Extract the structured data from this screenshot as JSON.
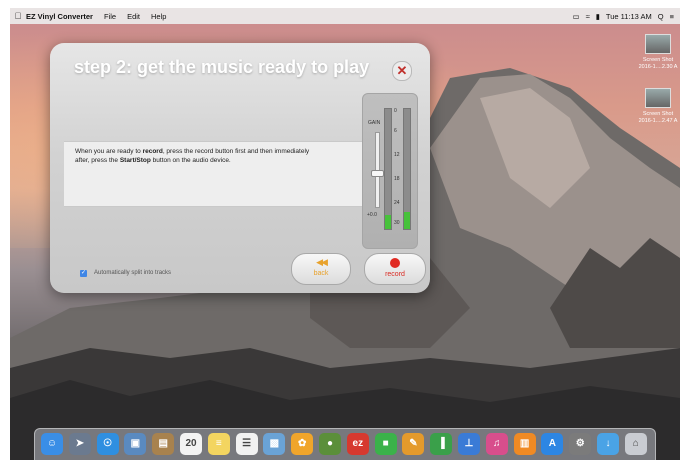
{
  "menubar": {
    "apple": "",
    "app_name": "EZ Vinyl Converter",
    "items": [
      "File",
      "Edit",
      "Help"
    ],
    "status": {
      "clock": "Tue 11:13 AM",
      "search": "Q",
      "menu": "≡"
    }
  },
  "desktop_files": [
    {
      "name": "Screen Shot",
      "date": "2016-1....2.30 A"
    },
    {
      "name": "Screen Shot",
      "date": "2016-1....2.47 A"
    }
  ],
  "dialog": {
    "title": "step 2: get the music ready to play",
    "close_glyph": "✕",
    "instructions_parts": [
      "When you are ready to ",
      "record",
      ", press the record button first and then immediately after, press the ",
      "Start/Stop",
      " button on the audio device."
    ],
    "gain_label": "GAIN",
    "gain_value": "+0.0",
    "vu_ticks": [
      "0",
      "6",
      "12",
      "18",
      "24",
      "30"
    ],
    "vu_levels": [
      0.12,
      0.14
    ],
    "gain_level": 0.5,
    "auto_split_checked": true,
    "auto_split_label": "Automatically split into tracks",
    "back_label": "back",
    "back_glyph": "◀◀",
    "record_label": "record"
  },
  "dock_items": [
    {
      "name": "finder-icon",
      "color": "#3a8ee6",
      "glyph": "☺"
    },
    {
      "name": "launchpad-icon",
      "color": "#6b7a8f",
      "glyph": "➤"
    },
    {
      "name": "safari-icon",
      "color": "#2f8fe0",
      "glyph": "☉"
    },
    {
      "name": "photo-browser-icon",
      "color": "#5a8ac0",
      "glyph": "▣"
    },
    {
      "name": "contacts-icon",
      "color": "#a8824e",
      "glyph": "▤"
    },
    {
      "name": "calendar-icon",
      "color": "#f3f3f3",
      "glyph": "20"
    },
    {
      "name": "notes-icon",
      "color": "#f3d560",
      "glyph": "≡"
    },
    {
      "name": "reminders-icon",
      "color": "#f2f2f2",
      "glyph": "☰"
    },
    {
      "name": "image-capture-icon",
      "color": "#6aa3d6",
      "glyph": "▩"
    },
    {
      "name": "photos-icon",
      "color": "#f0a52b",
      "glyph": "✿"
    },
    {
      "name": "chrome-icon",
      "color": "#5b8f3a",
      "glyph": "●"
    },
    {
      "name": "ez-vinyl-icon",
      "color": "#d6392f",
      "glyph": "ez"
    },
    {
      "name": "facetime-icon",
      "color": "#3bb24a",
      "glyph": "■"
    },
    {
      "name": "pages-icon",
      "color": "#e49a2c",
      "glyph": "✎"
    },
    {
      "name": "numbers-icon",
      "color": "#3aa04a",
      "glyph": "▐"
    },
    {
      "name": "keynote-icon",
      "color": "#3a7bd6",
      "glyph": "⊥"
    },
    {
      "name": "itunes-icon",
      "color": "#d84e8c",
      "glyph": "♫"
    },
    {
      "name": "ibooks-icon",
      "color": "#f08a24",
      "glyph": "▥"
    },
    {
      "name": "app-store-icon",
      "color": "#2d86e3",
      "glyph": "A"
    },
    {
      "name": "system-preferences-icon",
      "color": "#7b7b7b",
      "glyph": "⚙"
    },
    {
      "name": "downloads-folder-icon",
      "color": "#4aa3e6",
      "glyph": "↓"
    },
    {
      "name": "trash-icon",
      "color": "#c9ccd2",
      "glyph": "⌂"
    }
  ],
  "colors": {
    "accent_orange": "#e8a22c",
    "record_red": "#e02a22",
    "meter_green": "#47c23b",
    "checkbox_blue": "#3f86e6"
  }
}
